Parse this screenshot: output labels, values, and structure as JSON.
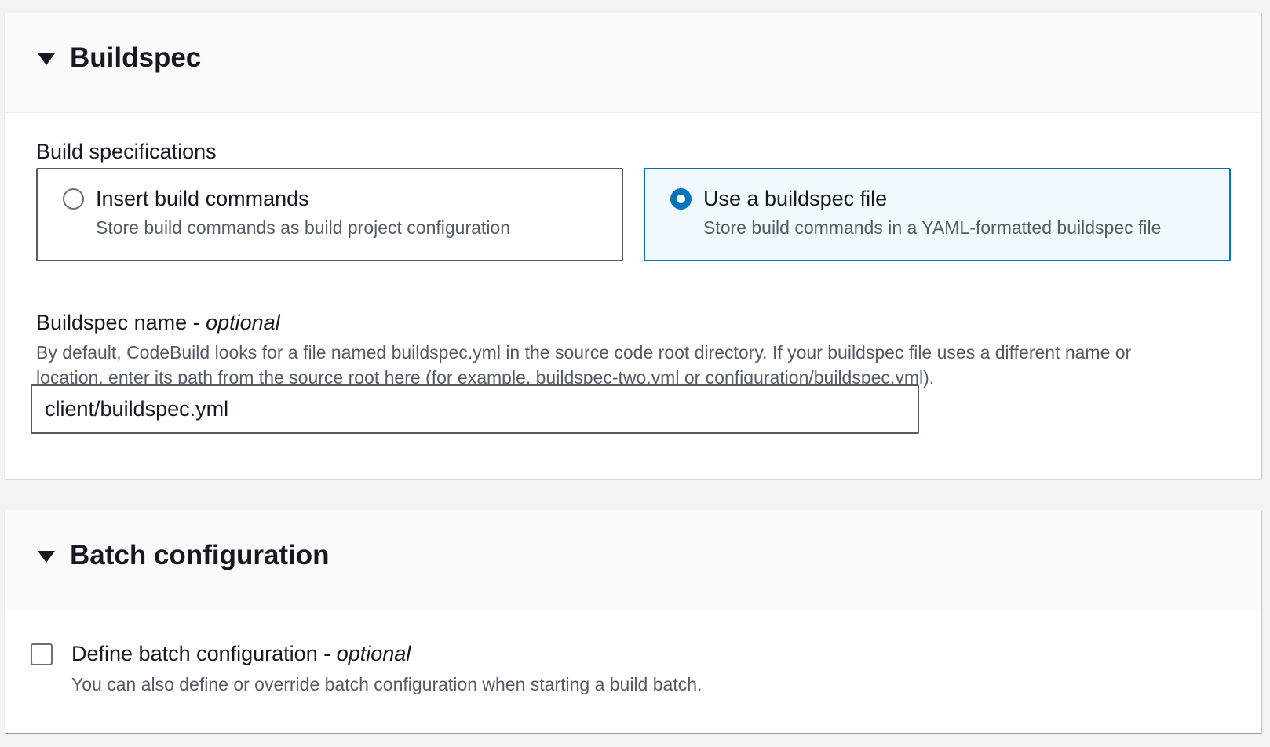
{
  "buildspec_section": {
    "title": "Buildspec",
    "build_specifications_label": "Build specifications",
    "options": [
      {
        "label": "Insert build commands",
        "description": "Store build commands as build project configuration",
        "selected": false
      },
      {
        "label": "Use a buildspec file",
        "description": "Store build commands in a YAML-formatted buildspec file",
        "selected": true
      }
    ],
    "buildspec_name": {
      "label": "Buildspec name - ",
      "optional_label": "optional",
      "description_line1": "By default, CodeBuild looks for a file named buildspec.yml in the source code root directory. If your buildspec file uses a different name or",
      "description_line2": "location, enter its path from the source root here (for example, buildspec-two.yml or configuration/buildspec.yml).",
      "value": "client/buildspec.yml"
    }
  },
  "batch_section": {
    "title": "Batch configuration",
    "define_batch": {
      "label": "Define batch configuration - ",
      "optional_label": "optional",
      "description": "You can also define or override batch configuration when starting a build batch.",
      "checked": false
    }
  },
  "icons": {
    "section_caret": "caret-down-icon"
  },
  "colors": {
    "selected_border": "#0073bb",
    "selected_background": "#f1faff",
    "text_primary": "#16191f",
    "text_secondary": "#545b64",
    "page_background": "#f2f3f3"
  }
}
